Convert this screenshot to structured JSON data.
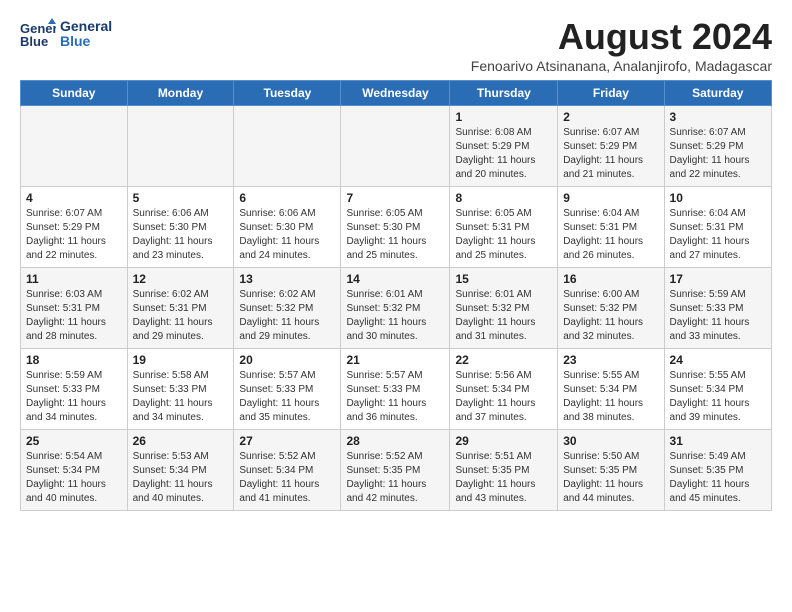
{
  "logo": {
    "line1": "General",
    "line2": "Blue"
  },
  "title": "August 2024",
  "subtitle": "Fenoarivo Atsinanana, Analanjirofo, Madagascar",
  "columns": [
    "Sunday",
    "Monday",
    "Tuesday",
    "Wednesday",
    "Thursday",
    "Friday",
    "Saturday"
  ],
  "weeks": [
    [
      {
        "day": "",
        "info": ""
      },
      {
        "day": "",
        "info": ""
      },
      {
        "day": "",
        "info": ""
      },
      {
        "day": "",
        "info": ""
      },
      {
        "day": "1",
        "info": "Sunrise: 6:08 AM\nSunset: 5:29 PM\nDaylight: 11 hours and 20 minutes."
      },
      {
        "day": "2",
        "info": "Sunrise: 6:07 AM\nSunset: 5:29 PM\nDaylight: 11 hours and 21 minutes."
      },
      {
        "day": "3",
        "info": "Sunrise: 6:07 AM\nSunset: 5:29 PM\nDaylight: 11 hours and 22 minutes."
      }
    ],
    [
      {
        "day": "4",
        "info": "Sunrise: 6:07 AM\nSunset: 5:29 PM\nDaylight: 11 hours and 22 minutes."
      },
      {
        "day": "5",
        "info": "Sunrise: 6:06 AM\nSunset: 5:30 PM\nDaylight: 11 hours and 23 minutes."
      },
      {
        "day": "6",
        "info": "Sunrise: 6:06 AM\nSunset: 5:30 PM\nDaylight: 11 hours and 24 minutes."
      },
      {
        "day": "7",
        "info": "Sunrise: 6:05 AM\nSunset: 5:30 PM\nDaylight: 11 hours and 25 minutes."
      },
      {
        "day": "8",
        "info": "Sunrise: 6:05 AM\nSunset: 5:31 PM\nDaylight: 11 hours and 25 minutes."
      },
      {
        "day": "9",
        "info": "Sunrise: 6:04 AM\nSunset: 5:31 PM\nDaylight: 11 hours and 26 minutes."
      },
      {
        "day": "10",
        "info": "Sunrise: 6:04 AM\nSunset: 5:31 PM\nDaylight: 11 hours and 27 minutes."
      }
    ],
    [
      {
        "day": "11",
        "info": "Sunrise: 6:03 AM\nSunset: 5:31 PM\nDaylight: 11 hours and 28 minutes."
      },
      {
        "day": "12",
        "info": "Sunrise: 6:02 AM\nSunset: 5:31 PM\nDaylight: 11 hours and 29 minutes."
      },
      {
        "day": "13",
        "info": "Sunrise: 6:02 AM\nSunset: 5:32 PM\nDaylight: 11 hours and 29 minutes."
      },
      {
        "day": "14",
        "info": "Sunrise: 6:01 AM\nSunset: 5:32 PM\nDaylight: 11 hours and 30 minutes."
      },
      {
        "day": "15",
        "info": "Sunrise: 6:01 AM\nSunset: 5:32 PM\nDaylight: 11 hours and 31 minutes."
      },
      {
        "day": "16",
        "info": "Sunrise: 6:00 AM\nSunset: 5:32 PM\nDaylight: 11 hours and 32 minutes."
      },
      {
        "day": "17",
        "info": "Sunrise: 5:59 AM\nSunset: 5:33 PM\nDaylight: 11 hours and 33 minutes."
      }
    ],
    [
      {
        "day": "18",
        "info": "Sunrise: 5:59 AM\nSunset: 5:33 PM\nDaylight: 11 hours and 34 minutes."
      },
      {
        "day": "19",
        "info": "Sunrise: 5:58 AM\nSunset: 5:33 PM\nDaylight: 11 hours and 34 minutes."
      },
      {
        "day": "20",
        "info": "Sunrise: 5:57 AM\nSunset: 5:33 PM\nDaylight: 11 hours and 35 minutes."
      },
      {
        "day": "21",
        "info": "Sunrise: 5:57 AM\nSunset: 5:33 PM\nDaylight: 11 hours and 36 minutes."
      },
      {
        "day": "22",
        "info": "Sunrise: 5:56 AM\nSunset: 5:34 PM\nDaylight: 11 hours and 37 minutes."
      },
      {
        "day": "23",
        "info": "Sunrise: 5:55 AM\nSunset: 5:34 PM\nDaylight: 11 hours and 38 minutes."
      },
      {
        "day": "24",
        "info": "Sunrise: 5:55 AM\nSunset: 5:34 PM\nDaylight: 11 hours and 39 minutes."
      }
    ],
    [
      {
        "day": "25",
        "info": "Sunrise: 5:54 AM\nSunset: 5:34 PM\nDaylight: 11 hours and 40 minutes."
      },
      {
        "day": "26",
        "info": "Sunrise: 5:53 AM\nSunset: 5:34 PM\nDaylight: 11 hours and 40 minutes."
      },
      {
        "day": "27",
        "info": "Sunrise: 5:52 AM\nSunset: 5:34 PM\nDaylight: 11 hours and 41 minutes."
      },
      {
        "day": "28",
        "info": "Sunrise: 5:52 AM\nSunset: 5:35 PM\nDaylight: 11 hours and 42 minutes."
      },
      {
        "day": "29",
        "info": "Sunrise: 5:51 AM\nSunset: 5:35 PM\nDaylight: 11 hours and 43 minutes."
      },
      {
        "day": "30",
        "info": "Sunrise: 5:50 AM\nSunset: 5:35 PM\nDaylight: 11 hours and 44 minutes."
      },
      {
        "day": "31",
        "info": "Sunrise: 5:49 AM\nSunset: 5:35 PM\nDaylight: 11 hours and 45 minutes."
      }
    ]
  ]
}
